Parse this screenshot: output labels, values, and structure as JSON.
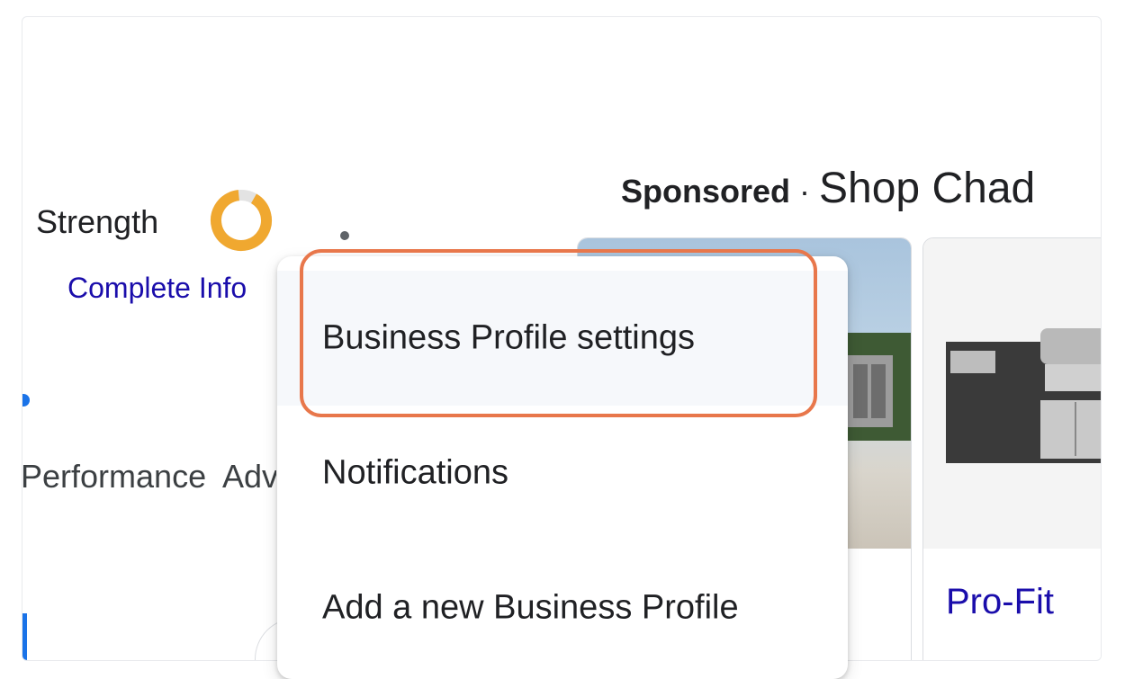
{
  "profile": {
    "strength_label": "Strength",
    "complete_info": "Complete Info",
    "strength_ring_fraction": 0.9
  },
  "tabs": [
    {
      "label": "Performance"
    },
    {
      "label": "Advertise"
    }
  ],
  "sponsored": {
    "label": "Sponsored",
    "separator": "·",
    "shop_text": "Shop Chad"
  },
  "products": [
    {
      "title": ""
    },
    {
      "title": "Pro-Fit"
    }
  ],
  "menu": {
    "items": [
      {
        "label": "Business Profile settings"
      },
      {
        "label": "Notifications"
      },
      {
        "label": "Add a new Business Profile"
      }
    ]
  },
  "colors": {
    "accent_orange": "#e8774b",
    "ring_orange": "#f0a830",
    "link_blue": "#1a0dab"
  }
}
